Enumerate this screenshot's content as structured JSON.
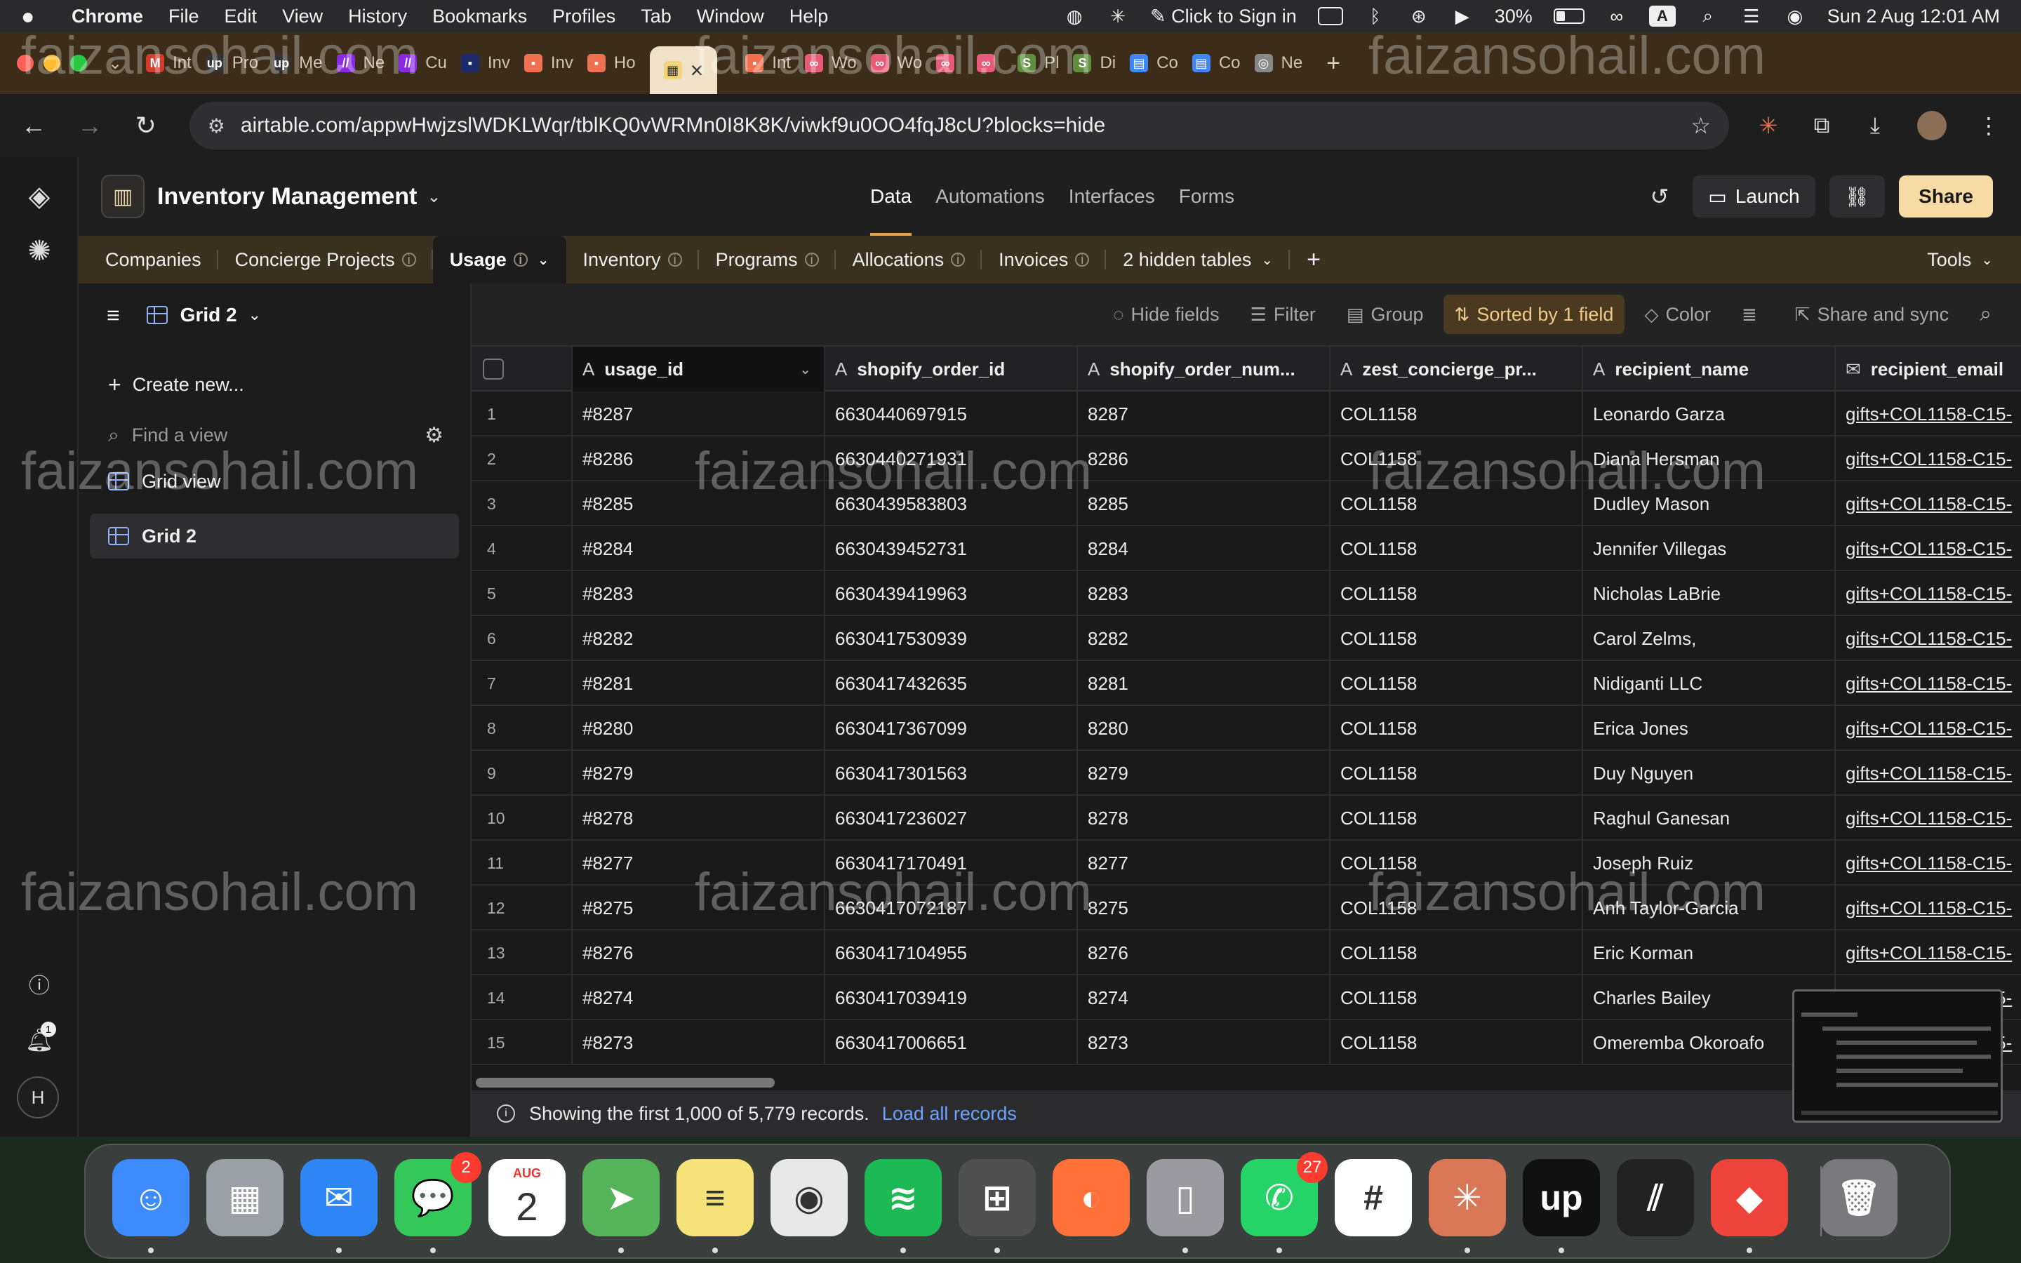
{
  "menubar": {
    "app": "Chrome",
    "items": [
      "File",
      "Edit",
      "View",
      "History",
      "Bookmarks",
      "Profiles",
      "Tab",
      "Window",
      "Help"
    ],
    "sign_in": "Click to Sign in",
    "battery": "30%",
    "input_source": "A",
    "datetime": "Sun 2 Aug  12:01 AM"
  },
  "browser": {
    "tabs": [
      {
        "label": "Int",
        "icon": "gmail-icon",
        "color": "#d33b2c",
        "glyph": "M"
      },
      {
        "label": "Pro",
        "icon": "upwork-icon",
        "color": "#333333",
        "glyph": "up"
      },
      {
        "label": "Me",
        "icon": "upwork-icon",
        "color": "#333333",
        "glyph": "up"
      },
      {
        "label": "Ne",
        "icon": "make-icon",
        "color": "#8a2be2",
        "glyph": "//"
      },
      {
        "label": "Cu",
        "icon": "make-icon",
        "color": "#8a2be2",
        "glyph": "//"
      },
      {
        "label": "Inv",
        "icon": "doc-icon",
        "color": "#1c2a6b",
        "glyph": "▪"
      },
      {
        "label": "Inv",
        "icon": "airtable-icon",
        "color": "#f07050",
        "glyph": "▪"
      },
      {
        "label": "Ho",
        "icon": "airtable-icon",
        "color": "#f07050",
        "glyph": "▪"
      }
    ],
    "active_tab_close": "×",
    "tabs_after": [
      {
        "label": "Int",
        "icon": "airtable-icon",
        "color": "#f07050",
        "glyph": "▪"
      },
      {
        "label": "Wo",
        "icon": "n8n-icon",
        "color": "#e85a7a",
        "glyph": "∞"
      },
      {
        "label": "Wo",
        "icon": "n8n-icon",
        "color": "#e85a7a",
        "glyph": "∞"
      },
      {
        "label": "",
        "icon": "n8n-icon",
        "color": "#e85a7a",
        "glyph": "∞"
      },
      {
        "label": "",
        "icon": "n8n-icon",
        "color": "#e85a7a",
        "glyph": "∞"
      },
      {
        "label": "Pl",
        "icon": "shopify-icon",
        "color": "#5e8e3e",
        "glyph": "S"
      },
      {
        "label": "Di",
        "icon": "shopify-icon",
        "color": "#5e8e3e",
        "glyph": "S"
      },
      {
        "label": "Co",
        "icon": "google-docs-icon",
        "color": "#4285f4",
        "glyph": "▤"
      },
      {
        "label": "Co",
        "icon": "google-docs-icon",
        "color": "#4285f4",
        "glyph": "▤"
      },
      {
        "label": "Ne",
        "icon": "chrome-icon",
        "color": "#888888",
        "glyph": "◎"
      }
    ],
    "url": "airtable.com/appwHwjzslWDKLWqr/tblKQ0vWRMn0I8K8K/viwkf9u0OO4fqJ8cU?blocks=hide"
  },
  "base": {
    "name": "Inventory Management",
    "nav": [
      "Data",
      "Automations",
      "Interfaces",
      "Forms"
    ],
    "launch": "Launch",
    "share": "Share"
  },
  "tables": {
    "items": [
      "Companies",
      "Concierge Projects",
      "Usage",
      "Inventory",
      "Programs",
      "Allocations",
      "Invoices"
    ],
    "hidden": "2 hidden tables",
    "tools": "Tools"
  },
  "sidebar": {
    "view_name": "Grid 2",
    "create_new": "Create new...",
    "find_placeholder": "Find a view",
    "views": [
      "Grid view",
      "Grid 2"
    ]
  },
  "viewbar": {
    "hide_fields": "Hide fields",
    "filter": "Filter",
    "group": "Group",
    "sorted": "Sorted by 1 field",
    "color": "Color",
    "share_sync": "Share and sync"
  },
  "grid": {
    "columns": [
      "usage_id",
      "shopify_order_id",
      "shopify_order_num...",
      "zest_concierge_pr...",
      "recipient_name",
      "recipient_email"
    ],
    "rows": [
      [
        "1",
        "#8287",
        "6630440697915",
        "8287",
        "COL1158",
        "Leonardo Garza",
        "gifts+COL1158-C15-"
      ],
      [
        "2",
        "#8286",
        "6630440271931",
        "8286",
        "COL1158",
        "Diana Hersman",
        "gifts+COL1158-C15-"
      ],
      [
        "3",
        "#8285",
        "6630439583803",
        "8285",
        "COL1158",
        "Dudley Mason",
        "gifts+COL1158-C15-"
      ],
      [
        "4",
        "#8284",
        "6630439452731",
        "8284",
        "COL1158",
        "Jennifer Villegas",
        "gifts+COL1158-C15-"
      ],
      [
        "5",
        "#8283",
        "6630439419963",
        "8283",
        "COL1158",
        "Nicholas LaBrie",
        "gifts+COL1158-C15-"
      ],
      [
        "6",
        "#8282",
        "6630417530939",
        "8282",
        "COL1158",
        "Carol Zelms,",
        "gifts+COL1158-C15-"
      ],
      [
        "7",
        "#8281",
        "6630417432635",
        "8281",
        "COL1158",
        "Nidiganti LLC",
        "gifts+COL1158-C15-"
      ],
      [
        "8",
        "#8280",
        "6630417367099",
        "8280",
        "COL1158",
        "Erica Jones",
        "gifts+COL1158-C15-"
      ],
      [
        "9",
        "#8279",
        "6630417301563",
        "8279",
        "COL1158",
        "Duy Nguyen",
        "gifts+COL1158-C15-"
      ],
      [
        "10",
        "#8278",
        "6630417236027",
        "8278",
        "COL1158",
        "Raghul Ganesan",
        "gifts+COL1158-C15-"
      ],
      [
        "11",
        "#8277",
        "6630417170491",
        "8277",
        "COL1158",
        "Joseph Ruiz",
        "gifts+COL1158-C15-"
      ],
      [
        "12",
        "#8275",
        "6630417072187",
        "8275",
        "COL1158",
        "Anh Taylor-Garcia",
        "gifts+COL1158-C15-"
      ],
      [
        "13",
        "#8276",
        "6630417104955",
        "8276",
        "COL1158",
        "Eric Korman",
        "gifts+COL1158-C15-"
      ],
      [
        "14",
        "#8274",
        "6630417039419",
        "8274",
        "COL1158",
        "Charles Bailey",
        "gifts+COL1158-C15-"
      ],
      [
        "15",
        "#8273",
        "6630417006651",
        "8273",
        "COL1158",
        "Omeremba Okoroafo",
        "gifts+COL1158-C15-"
      ]
    ]
  },
  "footer": {
    "info": "Showing the first 1,000 of 5,779 records.",
    "link": "Load all records"
  },
  "rail": {
    "notification_count": "1",
    "user_initial": "H"
  },
  "watermark": "faizansohail.com",
  "dock": {
    "apps": [
      {
        "name": "finder-icon",
        "color": "#3d8bfd",
        "glyph": "☺"
      },
      {
        "name": "launchpad-icon",
        "color": "#9aa0a6",
        "glyph": "▦"
      },
      {
        "name": "mail-icon",
        "color": "#2f86f6",
        "glyph": "✉"
      },
      {
        "name": "messages-icon",
        "color": "#34c759",
        "glyph": "💬",
        "badge": "2"
      },
      {
        "name": "calendar-icon",
        "color": "#ffffff",
        "glyph": "2"
      },
      {
        "name": "maps-icon",
        "color": "#55b35a",
        "glyph": "➤"
      },
      {
        "name": "notes-icon",
        "color": "#f7e27a",
        "glyph": "≡"
      },
      {
        "name": "chrome-icon",
        "color": "#e8e8e8",
        "glyph": "◉"
      },
      {
        "name": "spotify-icon",
        "color": "#1db954",
        "glyph": "≋"
      },
      {
        "name": "calculator-icon",
        "color": "#505050",
        "glyph": "⊞"
      },
      {
        "name": "firefox-icon",
        "color": "#ff7139",
        "glyph": "◐"
      },
      {
        "name": "iphone-mirroring-icon",
        "color": "#9a9aa0",
        "glyph": "▯"
      },
      {
        "name": "whatsapp-icon",
        "color": "#25d366",
        "glyph": "✆",
        "badge": "27"
      },
      {
        "name": "slack-icon",
        "color": "#ffffff",
        "glyph": "#"
      },
      {
        "name": "claude-icon",
        "color": "#d97757",
        "glyph": "✳"
      },
      {
        "name": "upwork-icon",
        "color": "#111111",
        "glyph": "up"
      },
      {
        "name": "app-icon",
        "color": "#222222",
        "glyph": "⫽"
      },
      {
        "name": "anydesk-icon",
        "color": "#ef443b",
        "glyph": "◆"
      },
      {
        "name": "trash-icon",
        "color": "#7a7a7e",
        "glyph": "🗑"
      }
    ],
    "calendar_month": "AUG"
  }
}
